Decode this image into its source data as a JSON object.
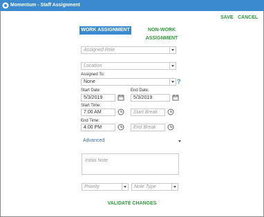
{
  "window": {
    "title": "Momentum - Staff Assignment",
    "logo_icon": "momentum-logo-icon"
  },
  "toolbar": {
    "save_label": "SAVE",
    "cancel_label": "CANCEL"
  },
  "tabs": {
    "work": "WORK ASSIGNMENT",
    "non_work": "NON-WORK ASSIGNMENT"
  },
  "form": {
    "assigned_role_placeholder": "Assigned Role",
    "location_placeholder": "Location",
    "assigned_to_label": "Assigned To:",
    "assigned_to_value": "None",
    "help_label": "?",
    "start_date_label": "Start Date:",
    "start_date_value": "5/3/2019",
    "end_date_label": "End Date:",
    "end_date_value": "5/3/2019",
    "start_time_label": "Start Time:",
    "start_time_value": "7:00 AM",
    "start_break_placeholder": "Start Break",
    "end_time_label": "End Time:",
    "end_time_value": "4:00 PM",
    "end_break_placeholder": "End Break",
    "advanced_label": "Advanced",
    "initial_note_placeholder": "Initial Note",
    "priority_placeholder": "Priority",
    "note_type_placeholder": "Note Type",
    "validate_label": "VALIDATE CHANGES"
  },
  "colors": {
    "accent_blue": "#3b8ad0",
    "action_green": "#2e9c3a"
  }
}
